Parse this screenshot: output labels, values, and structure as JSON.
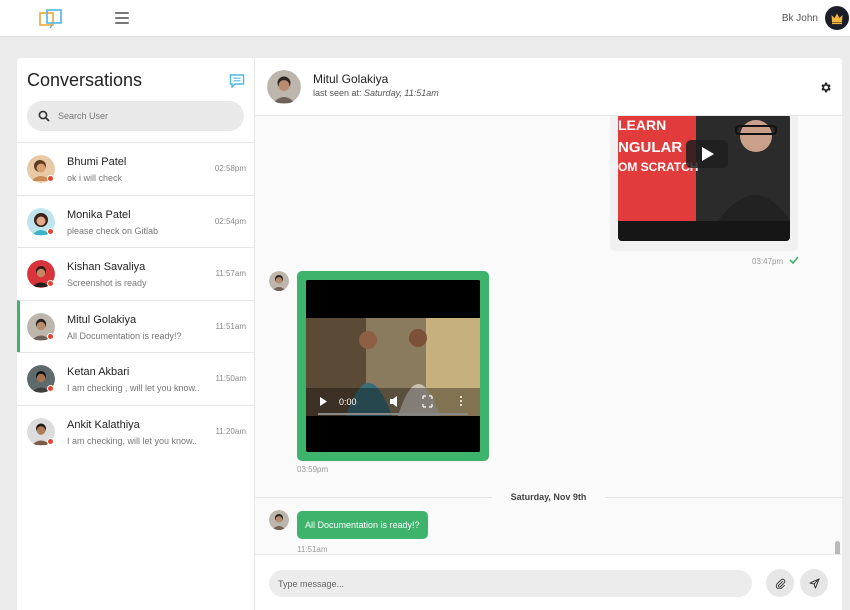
{
  "topbar": {
    "user_name": "Bk John",
    "logo_icon": "logo-icon",
    "menu_icon": "hamburger-icon"
  },
  "sidebar": {
    "title": "Conversations",
    "search_placeholder": "Search User",
    "items": [
      {
        "name": "Bhumi Patel",
        "preview": "ok i will check",
        "time": "02:58pm",
        "avatar_color": "#c98a55"
      },
      {
        "name": "Monika Patel",
        "preview": "please check on Gitlab",
        "time": "02:54pm",
        "avatar_color": "#3bb3c7"
      },
      {
        "name": "Kishan Savaliya",
        "preview": "Screenshot is ready",
        "time": "11:57am",
        "avatar_color": "#d7353a"
      },
      {
        "name": "Mitul Golakiya",
        "preview": "All Documentation is ready!?",
        "time": "11:51am",
        "avatar_color": "#6d6259",
        "active": true
      },
      {
        "name": "Ketan Akbari",
        "preview": "I am checking , will let you know..",
        "time": "11:50am",
        "avatar_color": "#3d3d3d"
      },
      {
        "name": "Ankit Kalathiya",
        "preview": "I am checking, will let you know..",
        "time": "11:20am",
        "avatar_color": "#7a5a45"
      }
    ]
  },
  "chat": {
    "contact_name": "Mitul Golakiya",
    "last_seen_prefix": "last seen at:",
    "last_seen_value": "Saturday, 11:51am",
    "video_out_text1": "LEARN",
    "video_out_text2": "NGULAR",
    "video_out_text3": "OM SCRATCH",
    "video_out_time": "03:47pm",
    "video_in_time_display": "0:00",
    "video_in_time": "03:59pm",
    "date_divider": "Saturday, Nov 9th",
    "last_message": "All Documentation is ready!?",
    "last_message_time": "11:51am",
    "composer_placeholder": "Type message..."
  },
  "colors": {
    "accent": "#3db36b",
    "status_offline": "#e2452f",
    "icon_blue": "#4fb6e3"
  }
}
